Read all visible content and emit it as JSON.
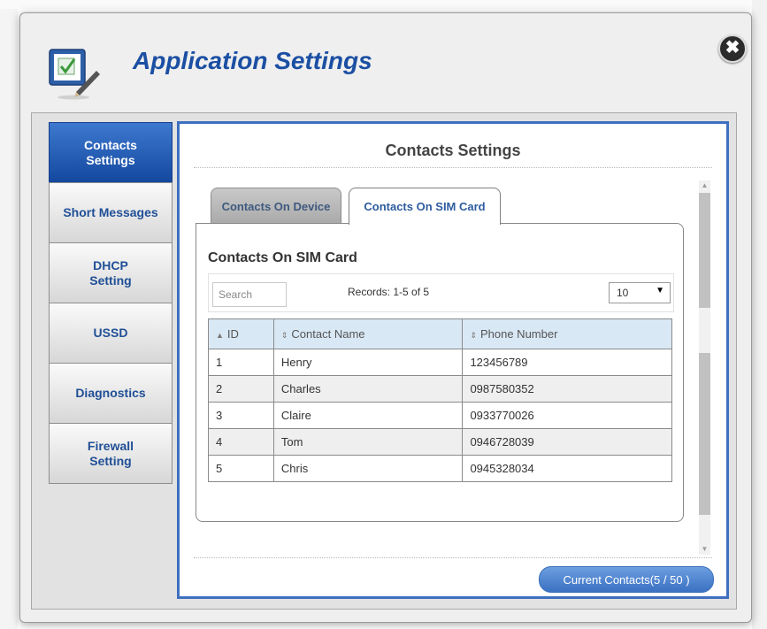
{
  "dialog": {
    "title": "Application Settings",
    "close_symbol": "✖"
  },
  "sidebar": {
    "items": [
      {
        "label": "Contacts\nSettings",
        "active": true
      },
      {
        "label": "Short Messages",
        "active": false
      },
      {
        "label": "DHCP\nSetting",
        "active": false
      },
      {
        "label": "USSD",
        "active": false
      },
      {
        "label": "Diagnostics",
        "active": false
      },
      {
        "label": "Firewall\nSetting",
        "active": false
      }
    ]
  },
  "main": {
    "title": "Contacts Settings",
    "tabs": [
      {
        "label": "Contacts On Device",
        "active": false
      },
      {
        "label": "Contacts On SIM Card",
        "active": true
      }
    ],
    "section_title": "Contacts On SIM Card",
    "search": {
      "placeholder": "Search",
      "value": ""
    },
    "records_text": "Records: 1-5 of 5",
    "page_size": {
      "selected": "10"
    },
    "table": {
      "columns": [
        "ID",
        "Contact Name",
        "Phone Number"
      ],
      "rows": [
        [
          "1",
          "Henry",
          "123456789"
        ],
        [
          "2",
          "Charles",
          "0987580352"
        ],
        [
          "3",
          "Claire",
          "0933770026"
        ],
        [
          "4",
          "Tom",
          "0946728039"
        ],
        [
          "5",
          "Chris",
          "0945328034"
        ]
      ]
    },
    "current_contacts_label": "Current Contacts(5 / 50 )"
  },
  "colors": {
    "title_blue": "#1b4fa3",
    "active_nav": "#1f5bb5",
    "panel_border": "#3f6fc0",
    "table_header": "#d9e8f5",
    "button_blue": "#4a80cc"
  },
  "icons": {
    "logo": "settings-checklist-pencil-icon",
    "close": "close-icon",
    "sort": "sort-icon",
    "dropdown": "chevron-down-icon"
  }
}
